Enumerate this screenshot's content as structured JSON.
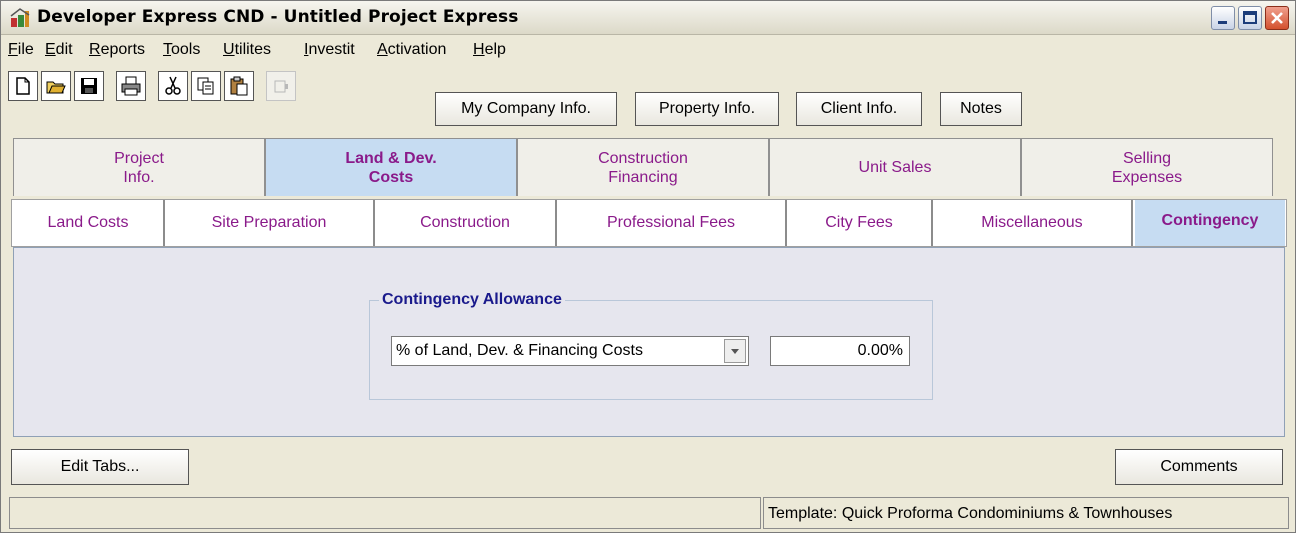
{
  "window": {
    "title": "Developer Express  CND - Untitled Project Express",
    "app_icon": "developer-express-icon",
    "controls": [
      "minimize-icon",
      "maximize-icon",
      "close-icon"
    ]
  },
  "menu": [
    "File",
    "Edit",
    "Reports",
    "Tools",
    "Utilites",
    "Investit",
    "Activation",
    "Help"
  ],
  "toolbar": {
    "icons": [
      "new-document-icon",
      "open-folder-icon",
      "save-icon",
      "print-icon",
      "cut-icon",
      "copy-icon",
      "paste-icon",
      "disabled-tool-icon"
    ],
    "buttons": [
      "My Company Info.",
      "Property Info.",
      "Client Info.",
      "Notes"
    ]
  },
  "main_tabs": [
    {
      "label": "Project\nInfo.",
      "active": false
    },
    {
      "label": "Land & Dev.\nCosts",
      "active": true
    },
    {
      "label": "Construction\nFinancing",
      "active": false
    },
    {
      "label": "Unit Sales",
      "active": false
    },
    {
      "label": "Selling\nExpenses",
      "active": false
    }
  ],
  "sub_tabs": [
    {
      "label": "Land Costs",
      "active": false
    },
    {
      "label": "Site Preparation",
      "active": false
    },
    {
      "label": "Construction",
      "active": false
    },
    {
      "label": "Professional Fees",
      "active": false
    },
    {
      "label": "City Fees",
      "active": false
    },
    {
      "label": "Miscellaneous",
      "active": false
    },
    {
      "label": "Contingency",
      "active": true
    }
  ],
  "contingency": {
    "group_label": "Contingency Allowance",
    "basis_selected": "% of Land, Dev. & Financing Costs",
    "value": "0.00%"
  },
  "bottom": {
    "edit_tabs_label": "Edit Tabs...",
    "comments_label": "Comments"
  },
  "status": {
    "left": "",
    "template": "Template: Quick Proforma Condominiums & Townhouses"
  },
  "colors": {
    "tab_text": "#8a1a8a",
    "active_tab_bg": "#c6dcf2",
    "group_label": "#1a1a8c",
    "close_button": "#d3502e"
  }
}
